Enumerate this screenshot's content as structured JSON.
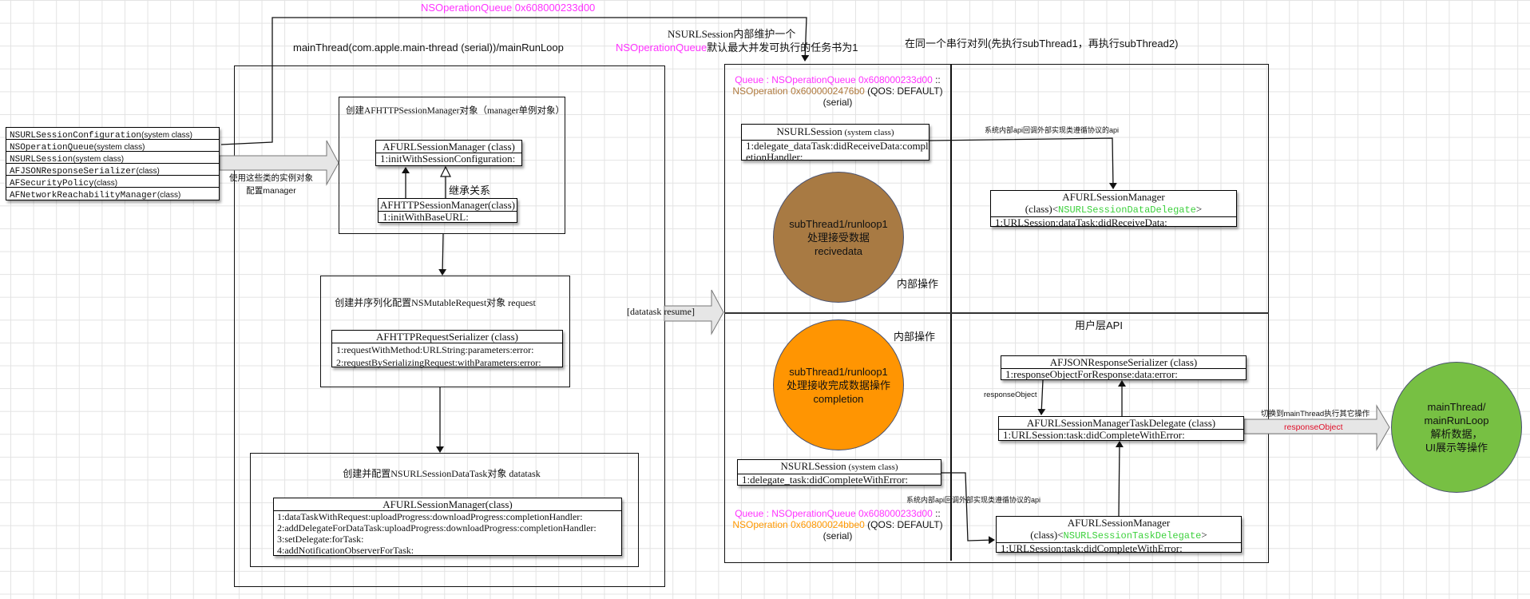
{
  "colors": {
    "pink": "#ff33ff",
    "brown_text": "#b07a3e",
    "orange_text": "#ff9800",
    "green_text": "#3dd13d",
    "red_text": "#e0102a",
    "brown_circle": "#a87a43",
    "orange_circle": "#ff9502",
    "green_circle": "#77c043"
  },
  "header": {
    "queue_label": "NSOperationQueue 0x608000233d00",
    "main_thread": "mainThread(com.apple.main-thread (serial))/mainRunLoop",
    "session_note_line1": "NSURLSession内部维护一个",
    "session_note_queue": "NSOperationQueue",
    "session_note_rest": "默认最大并发可执行的任务书为1",
    "serial_note": "在同一个串行对列(先执行subThread1，再执行subThread2)"
  },
  "class_list": [
    {
      "name": "NSURLSessionConfiguration",
      "kind": "(system class)"
    },
    {
      "name": "NSOperationQueue",
      "kind": "(system class)"
    },
    {
      "name": "NSURLSession",
      "kind": "(system class)"
    },
    {
      "name": "AFJSONResponseSerializer",
      "kind": "(class)"
    },
    {
      "name": "AFSecurityPolicy",
      "kind": "(class)"
    },
    {
      "name": "AFNetworkReachabilityManager",
      "kind": "(class)"
    }
  ],
  "config_arrow_label": "使用这些类的实例对象配置manager",
  "create_manager": {
    "title": "创建AFHTTPSessionManager对象（manager单例对象）",
    "url_manager": {
      "header": "AFURLSessionManager (class)",
      "methods": [
        "1:initWithSessionConfiguration:"
      ]
    },
    "inherit_label": "继承关系",
    "http_manager": {
      "header": "AFHTTPSessionManager(class)",
      "methods": [
        "1:initWithBaseURL:"
      ]
    }
  },
  "create_request": {
    "title": "创建并序列化配置NSMutableRequest对象 request",
    "serializer": {
      "header": "AFHTTPRequestSerializer (class)",
      "methods": [
        "1:requestWithMethod:URLString:parameters:error:",
        "2:requestBySerializingRequest:withParameters:error:"
      ]
    }
  },
  "create_datatask": {
    "title": "创建并配置NSURLSessionDataTask对象 datatask",
    "manager": {
      "header": "AFURLSessionManager(class)",
      "methods": [
        "1:dataTaskWithRequest:uploadProgress:downloadProgress:completionHandler:",
        "2:addDelegateForDataTask:uploadProgress:downloadProgress:completionHandler:",
        "3:setDelegate:forTask:",
        "4:addNotificationObserverForTask:"
      ]
    }
  },
  "resume_label": "[datatask resume]",
  "queue_panel": {
    "top_queue": {
      "queue": "Queue : NSOperationQueue 0x608000233d00",
      "sep": " ::",
      "operation": "NSOperation 0x6000002476b0",
      "qos": " (QOS: DEFAULT)",
      "serial": "(serial)"
    },
    "session_receive": {
      "header_name": "NSURLSession",
      "header_kind": " (system class)",
      "methods": [
        "1:delegate_dataTask:didReceiveData:compl",
        "etionHandler:"
      ]
    },
    "receive_circle": [
      "subThread1/runloop1",
      "处理接受数据",
      "recivedata"
    ],
    "internal_op_1": "内部操作",
    "complete_circle": [
      "subThread1/runloop1",
      "处理接收完成数据操作",
      "completion"
    ],
    "internal_op_2": "内部操作",
    "session_complete": {
      "header_name": "NSURLSession",
      "header_kind": " (system class)",
      "methods": [
        "1:delegate_task:didCompleteWithError:"
      ]
    },
    "bottom_queue": {
      "queue": "Queue : NSOperationQueue 0x608000233d00",
      "sep": " ::",
      "operation": "NSOperation 0x60800024bbe0",
      "qos": " (QOS: DEFAULT)",
      "serial": "(serial)"
    }
  },
  "user_panel": {
    "callback_label_1": "系统内部api回调外部实现类遵循协议的api",
    "data_delegate_manager": {
      "header_line1": "AFURLSessionManager",
      "header_class": "(class)<",
      "protocol": "NSURLSessionDataDelegate",
      "close": ">",
      "methods": [
        "1:URLSession:dataTask:didReceiveData:"
      ]
    },
    "user_api_label": "用户层API",
    "json_serializer": {
      "header": "AFJSONResponseSerializer (class)",
      "methods": [
        "1:responseObjectForResponse:data:error:"
      ]
    },
    "response_object_label": "responseObject",
    "task_delegate": {
      "header": "AFURLSessionManagerTaskDelegate (class)",
      "methods": [
        "1:URLSession:task:didCompleteWithError:"
      ]
    },
    "callback_label_2": "系统内部api回调外部实现类遵循协议的api",
    "task_delegate_manager": {
      "header_line1": "AFURLSessionManager",
      "header_class": "(class)<",
      "protocol": "NSURLSessionTaskDelegate",
      "close": ">",
      "methods": [
        "1:URLSession:task:didCompleteWithError:"
      ]
    }
  },
  "switch_arrow": {
    "label": "切换到mainThread执行其它操作",
    "payload": "responseObject"
  },
  "main_circle": [
    "mainThread/",
    "mainRunLoop",
    "解析数据，",
    "UI展示等操作"
  ]
}
